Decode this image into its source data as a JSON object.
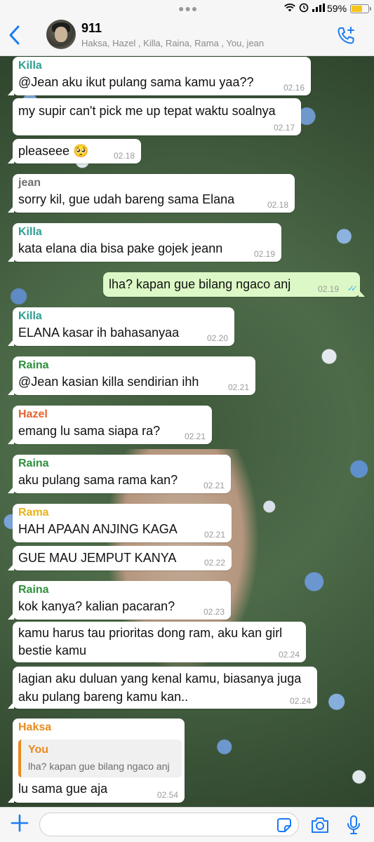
{
  "status_bar": {
    "battery": "59%",
    "battery_level": 0.59
  },
  "header": {
    "back_icon": "chevron-left-icon",
    "group_name": "911",
    "members": "Haksa, Hazel , Killa, Raina, Rama , You, jean",
    "call_icon": "phone-plus-icon"
  },
  "colors": {
    "accent": "#1a7cf5",
    "outgoing": "#dcf8c6",
    "killa": "#2e9e8f",
    "jean": "#6d6d6d",
    "raina": "#2f8f3c",
    "hazel": "#e3632e",
    "rama": "#e9b21b",
    "haksa": "#e88a1e",
    "read_ticks": "#4fb6ec"
  },
  "messages": [
    {
      "sender": "Killa",
      "text": "@Jean aku ikut pulang sama kamu yaa??",
      "time": "02.16"
    },
    {
      "text": "my supir can't pick me up tepat waktu soalnya",
      "time": "02.17"
    },
    {
      "text": "pleaseee 🥺",
      "time": "02.18"
    },
    {
      "sender": "jean",
      "text": "sorry kil, gue udah bareng sama Elana",
      "time": "02.18"
    },
    {
      "sender": "Killa",
      "text": "kata elana dia bisa pake gojek jeann",
      "time": "02.19"
    },
    {
      "text": "lha? kapan gue bilang ngaco anj",
      "time": "02.19",
      "outgoing": true
    },
    {
      "sender": "Killa",
      "text": "ELANA kasar ih bahasanyaa",
      "time": "02.20"
    },
    {
      "sender": "Raina",
      "text": "@Jean kasian killa sendirian ihh",
      "time": "02.21"
    },
    {
      "sender": "Hazel",
      "text": "emang lu sama siapa ra?",
      "time": "02.21"
    },
    {
      "sender": "Raina",
      "text": "aku pulang sama rama kan?",
      "time": "02.21"
    },
    {
      "sender": "Rama",
      "text": "HAH APAAN ANJING KAGA",
      "time": "02.21"
    },
    {
      "text": "GUE MAU JEMPUT KANYA",
      "time": "02.22"
    },
    {
      "sender": "Raina",
      "text": "kok kanya? kalian pacaran?",
      "time": "02.23"
    },
    {
      "text_line1": "kamu harus tau prioritas dong ram, aku kan girl",
      "text_line2": "bestie kamu",
      "time": "02.24"
    },
    {
      "text_line1": "lagian aku duluan yang kenal kamu, biasanya juga",
      "text_line2": "aku pulang bareng kamu kan..",
      "time": "02.24"
    },
    {
      "sender": "Haksa",
      "quote_name": "You",
      "quote_text": "lha? kapan gue bilang ngaco anj",
      "text": "lu sama gue aja",
      "time": "02.54"
    }
  ],
  "input_bar": {
    "plus_icon": "plus-icon",
    "sticker_icon": "sticker-icon",
    "camera_icon": "camera-icon",
    "mic_icon": "microphone-icon"
  }
}
